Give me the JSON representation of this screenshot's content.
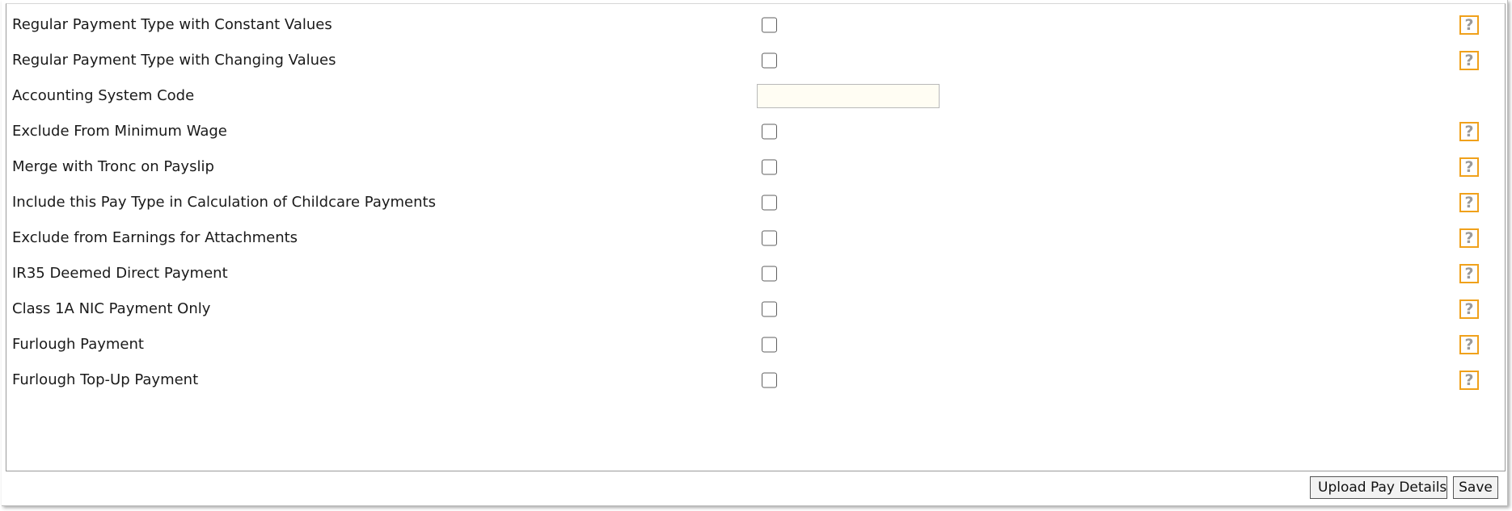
{
  "form": {
    "rows": [
      {
        "label": "Regular Payment Type with Constant Values",
        "type": "checkbox",
        "checked": false,
        "help_icon": "question-mark-icon"
      },
      {
        "label": "Regular Payment Type with Changing Values",
        "type": "checkbox",
        "checked": false,
        "help_icon": "question-mark-icon"
      },
      {
        "label": "Accounting System Code",
        "type": "text",
        "value": ""
      },
      {
        "label": "Exclude From Minimum Wage",
        "type": "checkbox",
        "checked": false,
        "help_icon": "question-mark-icon"
      },
      {
        "label": "Merge with Tronc on Payslip",
        "type": "checkbox",
        "checked": false,
        "help_icon": "question-mark-icon"
      },
      {
        "label": "Include this Pay Type in Calculation of Childcare Payments",
        "type": "checkbox",
        "checked": false,
        "help_icon": "question-mark-icon"
      },
      {
        "label": "Exclude from Earnings for Attachments",
        "type": "checkbox",
        "checked": false,
        "help_icon": "question-mark-icon"
      },
      {
        "label": "IR35 Deemed Direct Payment",
        "type": "checkbox",
        "checked": false,
        "help_icon": "question-mark-icon"
      },
      {
        "label": "Class 1A NIC Payment Only",
        "type": "checkbox",
        "checked": false,
        "help_icon": "question-mark-icon"
      },
      {
        "label": "Furlough Payment",
        "type": "checkbox",
        "checked": false,
        "help_icon": "question-mark-icon"
      },
      {
        "label": "Furlough Top-Up Payment",
        "type": "checkbox",
        "checked": false,
        "help_icon": "question-mark-icon"
      }
    ],
    "help_glyph": "?"
  },
  "actions": {
    "upload_label": "Upload Pay Details",
    "save_label": "Save"
  },
  "colors": {
    "help_border": "#f0a11b",
    "help_glyph": "#9a9a9a",
    "input_background": "#fffdf3"
  }
}
